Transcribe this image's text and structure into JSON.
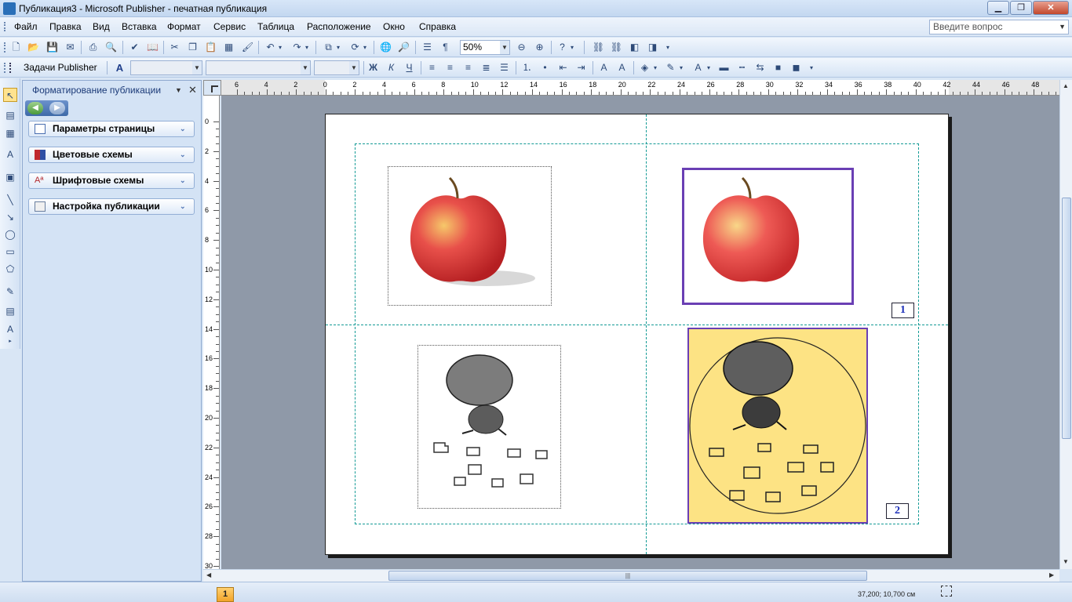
{
  "window": {
    "title": "Публикация3 - Microsoft Publisher - печатная публикация"
  },
  "menu": {
    "items": [
      "Файл",
      "Правка",
      "Вид",
      "Вставка",
      "Формат",
      "Сервис",
      "Таблица",
      "Расположение",
      "Окно",
      "Справка"
    ]
  },
  "help_box": {
    "placeholder": "Введите вопрос"
  },
  "toolbar_standard": {
    "zoom": "50%"
  },
  "toolbar_formatting": {
    "tasks_label": "Задачи Publisher",
    "bold": "Ж",
    "italic": "К",
    "underline": "Ч"
  },
  "task_pane": {
    "title": "Форматирование публикации",
    "sections": [
      "Параметры страницы",
      "Цветовые схемы",
      "Шрифтовые схемы",
      "Настройка публикации"
    ]
  },
  "ruler": {
    "h_labels": [
      "6",
      "4",
      "2",
      "0",
      "2",
      "4",
      "6",
      "8",
      "10",
      "12",
      "14",
      "16",
      "18",
      "20",
      "22",
      "24",
      "26",
      "28",
      "30",
      "32",
      "34",
      "36",
      "38",
      "40",
      "42",
      "44",
      "46",
      "48"
    ],
    "v_labels": [
      "0",
      "2",
      "4",
      "6",
      "8",
      "10",
      "12",
      "14",
      "16",
      "18",
      "20",
      "22",
      "24",
      "26",
      "28",
      "30"
    ]
  },
  "page_content": {
    "label_1": "1",
    "label_2": "2"
  },
  "status": {
    "page_number": "1",
    "coords": "37,200; 10,700 см"
  },
  "colors": {
    "accent_frame": "#6a3fb4",
    "guide": "#139a95",
    "picture_fill": "#fde384"
  }
}
